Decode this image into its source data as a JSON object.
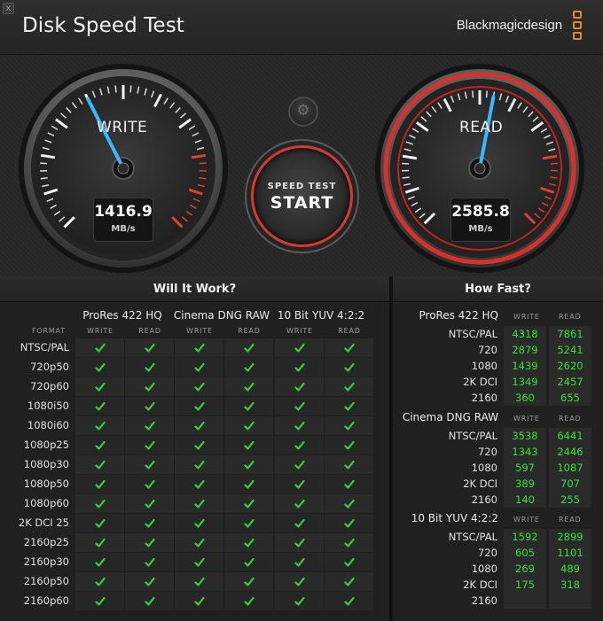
{
  "app": {
    "title": "Disk Speed Test",
    "brand": "Blackmagicdesign",
    "close_glyph": "x"
  },
  "gauges": {
    "write": {
      "label": "WRITE",
      "value": "1416.9",
      "unit": "MB/s",
      "needle_fraction": 0.4,
      "accent": "#3ab8ff"
    },
    "read": {
      "label": "READ",
      "value": "2585.8",
      "unit": "MB/s",
      "needle_fraction": 0.54,
      "accent": "#3ab8ff",
      "ring_color": "#d8302a"
    }
  },
  "controls": {
    "settings_icon": "gear-icon",
    "start_small": "SPEED TEST",
    "start_big": "START"
  },
  "will_it_work": {
    "title": "Will It Work?",
    "format_header": "FORMAT",
    "write_label": "WRITE",
    "read_label": "READ",
    "codecs": [
      "ProRes 422 HQ",
      "Cinema DNG RAW",
      "10 Bit YUV 4:2:2"
    ],
    "rows": [
      "NTSC/PAL",
      "720p50",
      "720p60",
      "1080i50",
      "1080i60",
      "1080p25",
      "1080p30",
      "1080p50",
      "1080p60",
      "2K DCI 25",
      "2160p25",
      "2160p30",
      "2160p50",
      "2160p60"
    ],
    "status": "all-pass",
    "check_color": "#36d336"
  },
  "how_fast": {
    "title": "How Fast?",
    "write_label": "WRITE",
    "read_label": "READ",
    "groups": [
      {
        "name": "ProRes 422 HQ",
        "rows": [
          {
            "label": "NTSC/PAL",
            "write": "4318",
            "read": "7861"
          },
          {
            "label": "720",
            "write": "2879",
            "read": "5241"
          },
          {
            "label": "1080",
            "write": "1439",
            "read": "2620"
          },
          {
            "label": "2K DCI",
            "write": "1349",
            "read": "2457"
          },
          {
            "label": "2160",
            "write": "360",
            "read": "655"
          }
        ]
      },
      {
        "name": "Cinema DNG RAW",
        "rows": [
          {
            "label": "NTSC/PAL",
            "write": "3538",
            "read": "6441"
          },
          {
            "label": "720",
            "write": "1343",
            "read": "2446"
          },
          {
            "label": "1080",
            "write": "597",
            "read": "1087"
          },
          {
            "label": "2K DCI",
            "write": "389",
            "read": "707"
          },
          {
            "label": "2160",
            "write": "140",
            "read": "255"
          }
        ]
      },
      {
        "name": "10 Bit YUV 4:2:2",
        "rows": [
          {
            "label": "NTSC/PAL",
            "write": "1592",
            "read": "2899"
          },
          {
            "label": "720",
            "write": "605",
            "read": "1101"
          },
          {
            "label": "1080",
            "write": "269",
            "read": "489"
          },
          {
            "label": "2K DCI",
            "write": "175",
            "read": "318"
          },
          {
            "label": "2160",
            "write": "",
            "read": ""
          }
        ]
      }
    ],
    "value_color": "#34e234"
  }
}
